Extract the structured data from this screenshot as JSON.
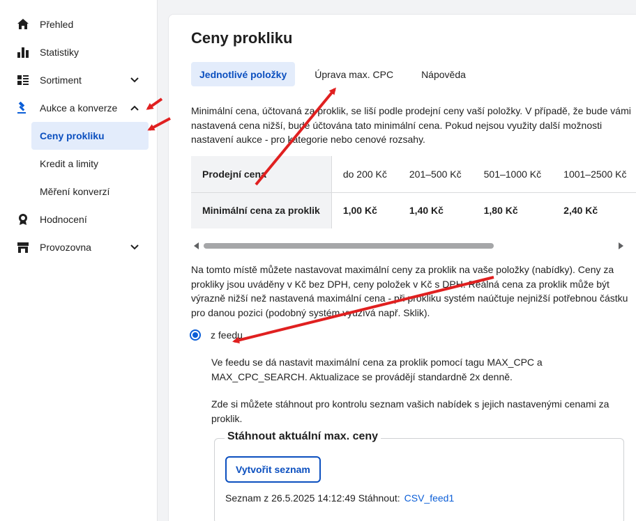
{
  "sidebar": {
    "items": [
      {
        "label": "Přehled",
        "icon": "home-icon"
      },
      {
        "label": "Statistiky",
        "icon": "bar-chart-icon"
      },
      {
        "label": "Sortiment",
        "icon": "list-icon"
      },
      {
        "label": "Aukce a konverze",
        "icon": "gavel-icon"
      },
      {
        "label": "Ceny prokliku"
      },
      {
        "label": "Kredit a limity"
      },
      {
        "label": "Měření konverzí"
      },
      {
        "label": "Hodnocení",
        "icon": "award-icon"
      },
      {
        "label": "Provozovna",
        "icon": "store-icon"
      }
    ]
  },
  "main": {
    "title": "Ceny prokliku",
    "tabs": [
      "Jednotlivé položky",
      "Úprava max. CPC",
      "Nápověda"
    ],
    "intro": "Minimální cena, účtovaná za proklik, se liší podle prodejní ceny vaší položky. V případě, že bude vámi nastavená cena nižší, bude účtována tato minimální cena. Pokud nejsou využity další možnosti nastavení aukce - pro kategorie nebo cenové rozsahy.",
    "table": {
      "row1_header": "Prodejní cena",
      "row2_header": "Minimální cena za proklik",
      "ranges": [
        "do 200 Kč",
        "201–500 Kč",
        "501–1000 Kč",
        "1001–2500 Kč"
      ],
      "prices": [
        "1,00 Kč",
        "1,40 Kč",
        "1,80 Kč",
        "2,40 Kč"
      ]
    },
    "description": "Na tomto místě můžete nastavovat maximální ceny za proklik na vaše položky (nabídky). Ceny za prokliky jsou uváděny v Kč bez DPH, ceny položek v Kč s DPH. Reálná cena za proklik může být výrazně nižší než nastavená maximální cena - při prokliku systém naúčtuje nejnižší potřebnou částku pro danou pozici (podobný systém využívá např. Sklik).",
    "radio_label": "z feedu",
    "feed_info_1": "Ve feedu se dá nastavit maximální cena za proklik pomocí tagu MAX_CPC a MAX_CPC_SEARCH. Aktualizace se provádějí standardně 2x denně.",
    "feed_info_2": "Zde si můžete stáhnout pro kontrolu seznam vašich nabídek s jejich nastavenými cenami za proklik.",
    "download_box": {
      "legend": "Stáhnout aktuální max. ceny",
      "button": "Vytvořit seznam",
      "list_prefix": "Seznam z 26.5.2025 14:12:49 Stáhnout:",
      "link": "CSV_feed1"
    }
  },
  "colors": {
    "accent": "#0b5ed7",
    "active_bg": "#e3ecfb",
    "annotation_arrow": "#e02020"
  }
}
